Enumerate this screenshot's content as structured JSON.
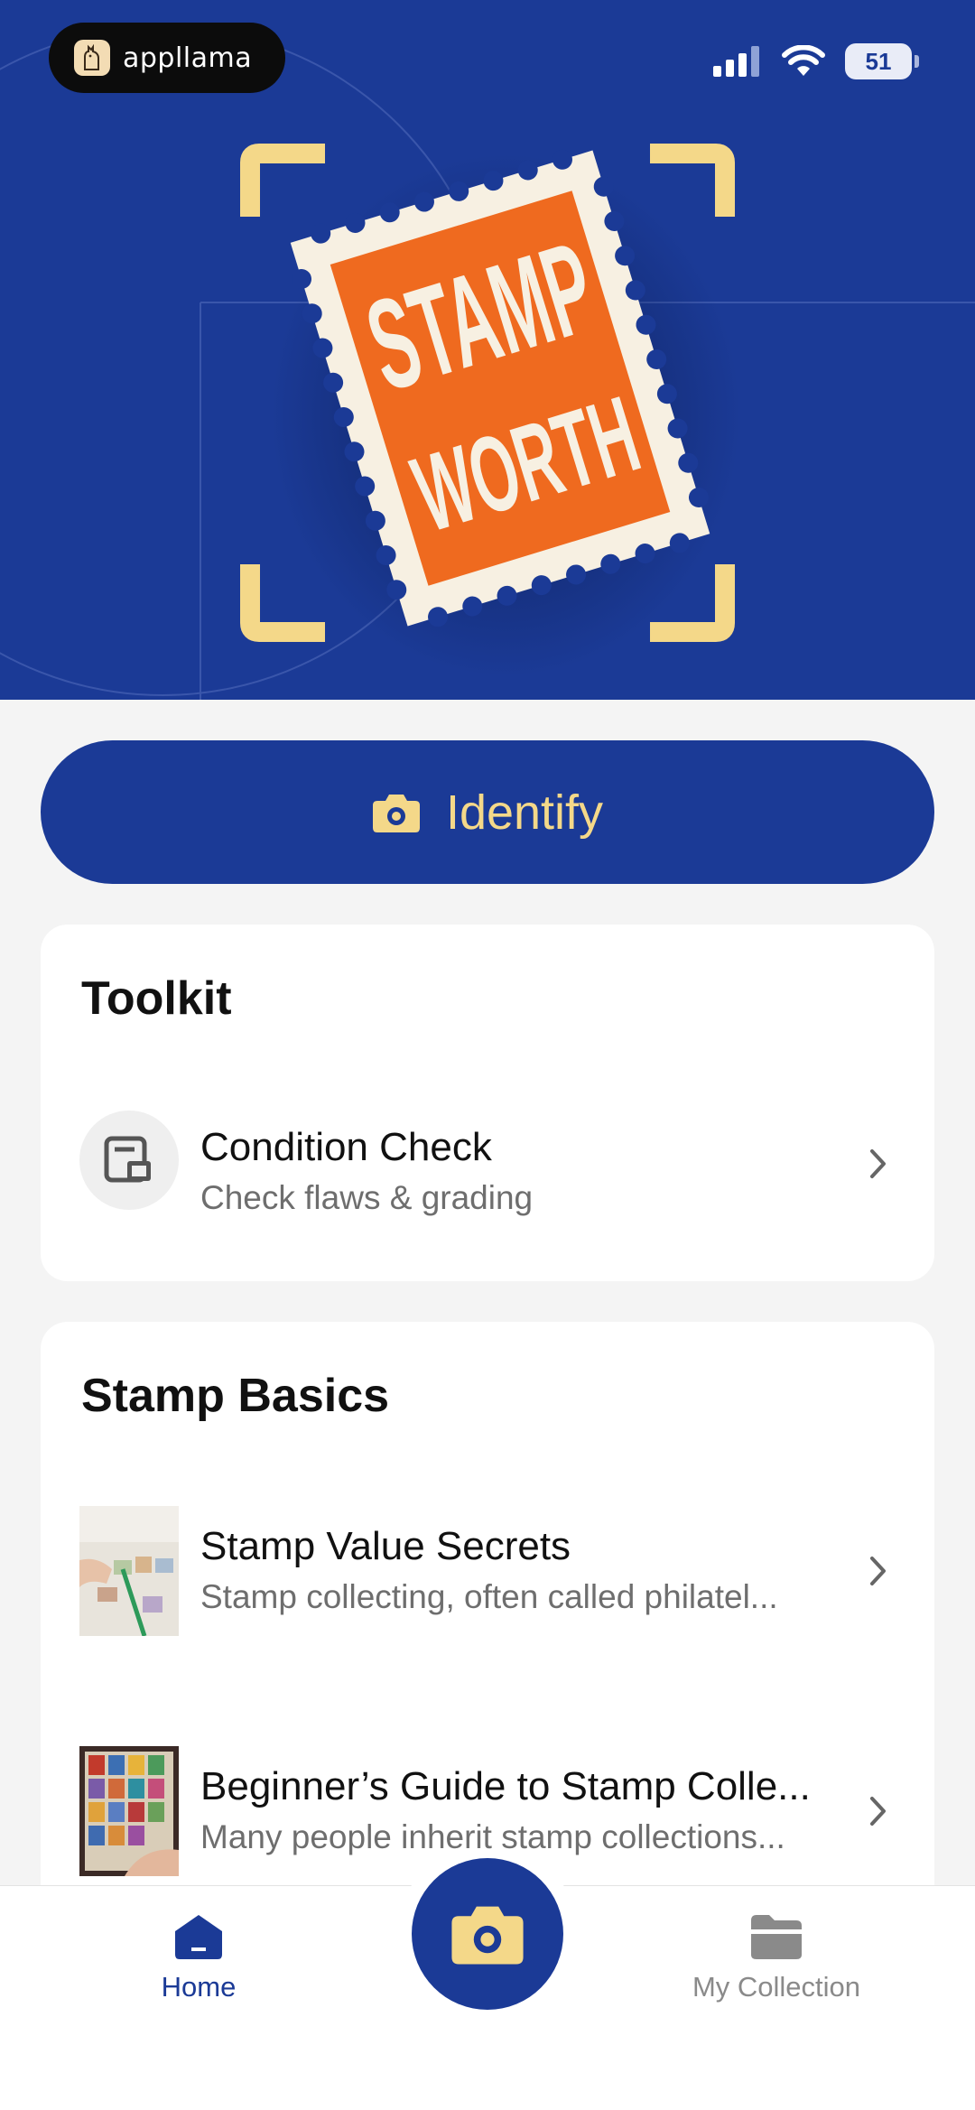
{
  "status_bar": {
    "badge_text": "appllama",
    "battery": "51",
    "icons": [
      "cellular-signal-icon",
      "wifi-icon",
      "battery-icon"
    ]
  },
  "hero": {
    "stamp_text": [
      "STAMP",
      "WORTH"
    ],
    "colors": {
      "background": "#1b3a96",
      "frame": "#f4d889",
      "stamp": "#ef6a1f"
    }
  },
  "identify": {
    "label": "Identify",
    "icon": "camera-icon"
  },
  "toolkit": {
    "title": "Toolkit",
    "items": [
      {
        "title": "Condition Check",
        "subtitle": "Check flaws & grading",
        "icon": "document-icon"
      }
    ]
  },
  "basics": {
    "title": "Stamp Basics",
    "items": [
      {
        "title": "Stamp Value Secrets",
        "subtitle": "Stamp collecting, often called philatel..."
      },
      {
        "title": "Beginner’s Guide to Stamp Colle...",
        "subtitle": "Many people inherit stamp collections..."
      }
    ]
  },
  "nav": {
    "home": "Home",
    "collection": "My Collection",
    "active": "home",
    "accent": "#1b3a96"
  }
}
